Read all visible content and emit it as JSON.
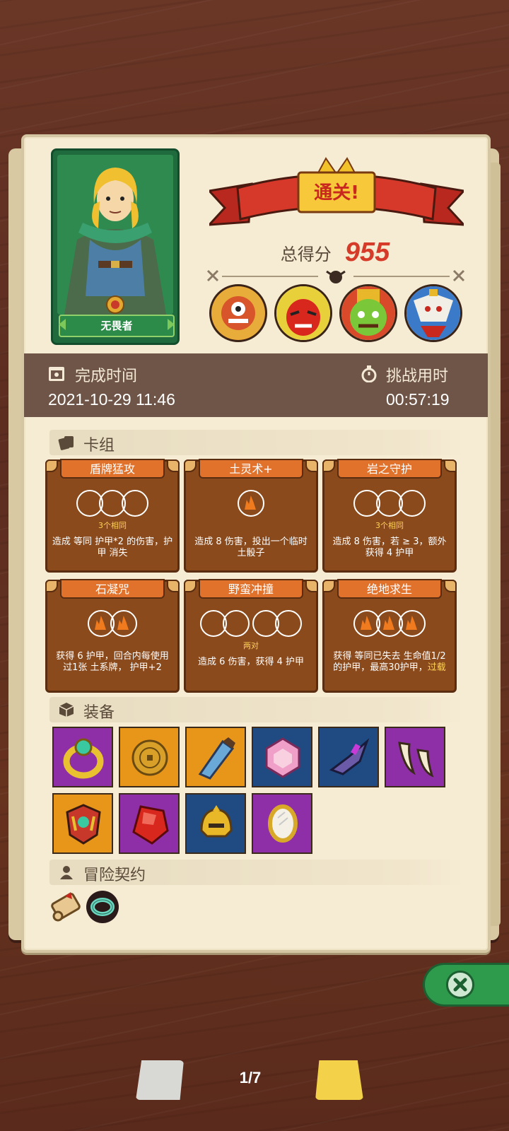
{
  "hero": {
    "name": "无畏者"
  },
  "result": {
    "banner": "通关!",
    "score_label": "总得分",
    "score_value": "955"
  },
  "time": {
    "finish_label": "完成时间",
    "finish_value": "2021-10-29 11:46",
    "challenge_label": "挑战用时",
    "challenge_value": "00:57:19"
  },
  "sections": {
    "deck": "卡组",
    "equipment": "装备",
    "contract": "冒险契约"
  },
  "cards": [
    {
      "title": "盾牌猛攻",
      "note": "3个相同",
      "desc": "造成 等同 护甲*2 的伤害，护甲 消失"
    },
    {
      "title": "土灵术+",
      "note": "",
      "desc": "造成 8 伤害，投出一个临时土骰子"
    },
    {
      "title": "岩之守护",
      "note": "3个相同",
      "desc": "造成 8 伤害，若 ≥ 3，额外获得 4 护甲"
    },
    {
      "title": "石凝咒",
      "note": "",
      "desc": "获得 6 护甲，回合内每使用过1张 土系牌， 护甲+2"
    },
    {
      "title": "野蛮冲撞",
      "note": "两对",
      "desc": "造成 6 伤害，获得 4 护甲"
    },
    {
      "title": "绝地求生",
      "note": "",
      "desc": "获得 等同已失去 生命值1/2 的护甲，最高30护甲，",
      "desc_highlight": "过载"
    }
  ],
  "pager": {
    "text": "1/7"
  },
  "colors": {
    "accent_red": "#d63a28",
    "card_brown": "#8a4a1c",
    "card_title": "#e0722c",
    "panel": "#f6ecd4",
    "time_bar": "#6e5547"
  }
}
